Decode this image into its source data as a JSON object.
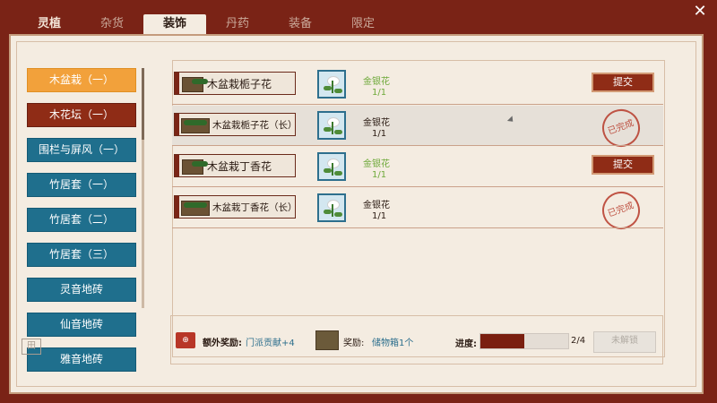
{
  "tabs": [
    "灵植",
    "杂货",
    "装饰",
    "丹药",
    "装备",
    "限定"
  ],
  "active_tab_index": 2,
  "close_icon": "close-icon",
  "sidebar": {
    "items": [
      "木盆栽（一）",
      "木花坛（一）",
      "围栏与屏风（一）",
      "竹居套（一）",
      "竹居套（二）",
      "竹居套（三）",
      "灵音地砖",
      "仙音地砖",
      "雅音地砖"
    ],
    "active_index": 0
  },
  "rows": [
    {
      "name": "木盆栽栀子花",
      "material": "金银花",
      "count": "1/1",
      "status": "submit",
      "submit_label": "提交"
    },
    {
      "name": "木盆栽栀子花（长）",
      "material": "金银花",
      "count": "1/1",
      "status": "done",
      "stamp_label": "已完成"
    },
    {
      "name": "木盆栽丁香花",
      "material": "金银花",
      "count": "1/1",
      "status": "submit",
      "submit_label": "提交"
    },
    {
      "name": "木盆栽丁香花（长）",
      "material": "金银花",
      "count": "1/1",
      "status": "done",
      "stamp_label": "已完成"
    }
  ],
  "bottom": {
    "bonus_label": "额外奖励:",
    "bonus_value": "门派贡献+4",
    "reward_label": "奖励:",
    "reward_value": "储物箱1个",
    "progress_label": "进度:",
    "progress_text": "2/4",
    "progress_fraction": 0.5,
    "unlock_label": "未解锁"
  },
  "colors": {
    "frame": "#7a2316",
    "panel_bg": "#f4ece1",
    "side_blue": "#1f6f8d",
    "side_orange": "#f2a13b",
    "side_red": "#8f2c16",
    "stamp": "#b73a2a",
    "green_text": "#6ea93a"
  }
}
